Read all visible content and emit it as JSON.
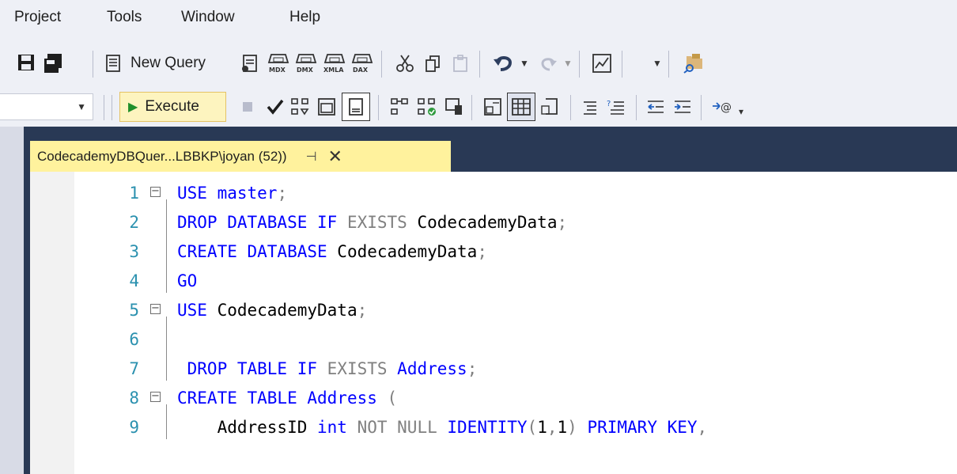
{
  "menu": [
    "Project",
    "Tools",
    "Window",
    "Help"
  ],
  "toolbar": {
    "new_query_label": "New Query",
    "search_text": ">",
    "execute_label": "Execute",
    "db_selector_value": ""
  },
  "tab": {
    "title": "CodecademyDBQuer...LBBKP\\joyan (52))",
    "pin_icon": "pin-icon",
    "close_icon": "close-icon"
  },
  "editor": {
    "line_numbers": [
      "1",
      "2",
      "3",
      "4",
      "5",
      "6",
      "7",
      "8",
      "9"
    ],
    "lines": [
      [
        {
          "t": "USE ",
          "c": "kw"
        },
        {
          "t": "master",
          "c": "kw"
        },
        {
          "t": ";",
          "c": "gr"
        }
      ],
      [
        {
          "t": "DROP DATABASE IF ",
          "c": "kw"
        },
        {
          "t": "EXISTS ",
          "c": "gr"
        },
        {
          "t": "CodecademyData",
          "c": "ob"
        },
        {
          "t": ";",
          "c": "gr"
        }
      ],
      [
        {
          "t": "CREATE DATABASE ",
          "c": "kw"
        },
        {
          "t": "CodecademyData",
          "c": "ob"
        },
        {
          "t": ";",
          "c": "gr"
        }
      ],
      [
        {
          "t": "GO",
          "c": "kw"
        }
      ],
      [
        {
          "t": "USE ",
          "c": "kw"
        },
        {
          "t": "CodecademyData",
          "c": "ob"
        },
        {
          "t": ";",
          "c": "gr"
        }
      ],
      [],
      [
        {
          "t": " DROP TABLE IF ",
          "c": "kw"
        },
        {
          "t": "EXISTS ",
          "c": "gr"
        },
        {
          "t": "Address",
          "c": "kw"
        },
        {
          "t": ";",
          "c": "gr"
        }
      ],
      [
        {
          "t": "CREATE TABLE ",
          "c": "kw"
        },
        {
          "t": "Address ",
          "c": "kw"
        },
        {
          "t": "(",
          "c": "gr"
        }
      ],
      [
        {
          "t": "    AddressID ",
          "c": "ob"
        },
        {
          "t": "int ",
          "c": "kw"
        },
        {
          "t": "NOT NULL ",
          "c": "gr"
        },
        {
          "t": "IDENTITY",
          "c": "kw"
        },
        {
          "t": "(",
          "c": "gr"
        },
        {
          "t": "1",
          "c": "num"
        },
        {
          "t": ",",
          "c": "gr"
        },
        {
          "t": "1",
          "c": "num"
        },
        {
          "t": ") ",
          "c": "gr"
        },
        {
          "t": "PRIMARY KEY",
          "c": "kw"
        },
        {
          "t": ",",
          "c": "gr"
        }
      ]
    ],
    "fold_lines": [
      1,
      5,
      8
    ]
  },
  "colors": {
    "keyword": "#0000ff",
    "operator_gray": "#808080",
    "line_number": "#2b91af",
    "tab_active": "#fff29d",
    "tabstrip": "#293955"
  }
}
